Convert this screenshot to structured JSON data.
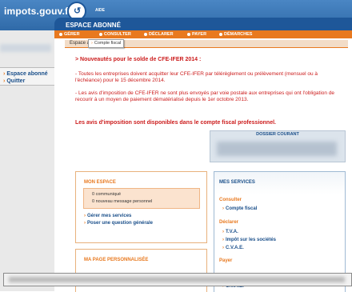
{
  "header": {
    "site_name": "impots.gouv.fr",
    "logo_glyph": "↺",
    "aide": "AIDE",
    "space_title": "ESPACE ABONNÉ"
  },
  "nav": {
    "items": [
      "GÉRER",
      "CONSULTER",
      "DÉCLARER",
      "PAYER",
      "DÉMARCHES"
    ],
    "submenu": "Compte fiscal"
  },
  "sidebar": {
    "items": [
      "Espace abonné",
      "Quitter"
    ]
  },
  "main": {
    "section_tab": "Espace abonné",
    "news_title": "> Nouveautés pour le solde de CFE-IFER 2014 :",
    "news_p1": "- Toutes les entreprises doivent acquitter leur CFE-IFER par télérèglement ou prélèvement (mensuel ou à l'échéance) pour le 15 décembre 2014.",
    "news_p2": "- Les avis d'imposition de CFE-IFER ne sont plus envoyés par voie postale aux entreprises qui ont l'obligation de recourir à un moyen de paiement dématérialisé depuis le 1er octobre 2013.",
    "news_bold": "Les avis d'imposition sont disponibles dans le compte fiscal professionnel."
  },
  "dossier": {
    "title": "DOSSIER COURANT"
  },
  "mon_espace": {
    "title": "MON ESPACE",
    "line1": "0 communiqué",
    "line2": "0 nouveau message personnel",
    "link1": "Gérer mes services",
    "link2": "Poser une question générale"
  },
  "ma_page": {
    "title": "MA PAGE PERSONNALISÉE"
  },
  "mes_services": {
    "title": "MES SERVICES",
    "consulter": "Consulter",
    "compte_fiscal": "Compte fiscal",
    "declarer": "Déclarer",
    "tva": "T.V.A.",
    "is": "Impôt sur les sociétés",
    "cvae": "C.V.A.E.",
    "payer": "Payer",
    "cvae2": "C.V.A.E."
  },
  "colors": {
    "brand_blue": "#1e5799",
    "accent_orange": "#e8791f",
    "alert_red": "#cc1c1c"
  }
}
